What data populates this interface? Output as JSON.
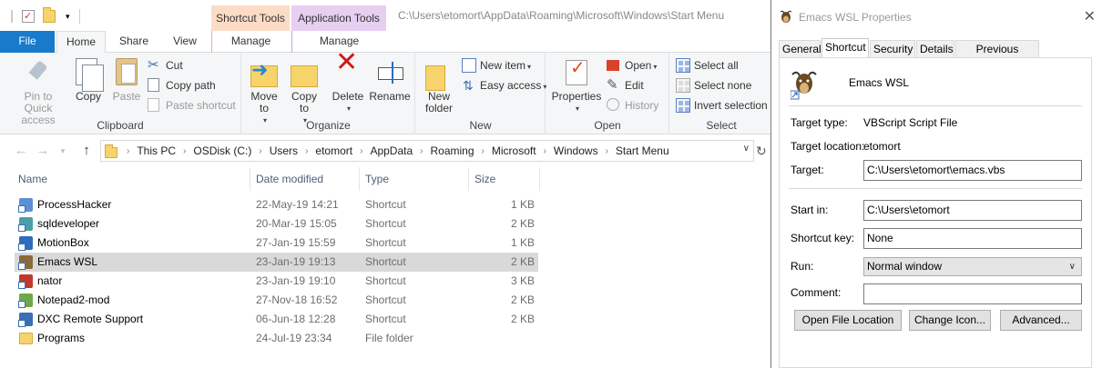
{
  "explorer": {
    "title_path": "C:\\Users\\etomort\\AppData\\Roaming\\Microsoft\\Windows\\Start Menu",
    "context_tabs": {
      "shortcut_tools": "Shortcut Tools",
      "application_tools": "Application Tools"
    },
    "tabs": {
      "file": "File",
      "home": "Home",
      "share": "Share",
      "view": "View",
      "manage1": "Manage",
      "manage2": "Manage"
    },
    "ribbon": {
      "clipboard": {
        "label": "Clipboard",
        "pin": "Pin to Quick access",
        "copy": "Copy",
        "paste": "Paste",
        "cut": "Cut",
        "copy_path": "Copy path",
        "paste_shortcut": "Paste shortcut"
      },
      "organize": {
        "label": "Organize",
        "move_to": "Move to",
        "copy_to": "Copy to",
        "delete": "Delete",
        "rename": "Rename"
      },
      "new": {
        "label": "New",
        "new_folder": "New folder",
        "new_item": "New item",
        "easy_access": "Easy access"
      },
      "open": {
        "label": "Open",
        "properties": "Properties",
        "open": "Open",
        "edit": "Edit",
        "history": "History"
      },
      "select": {
        "label": "Select",
        "select_all": "Select all",
        "select_none": "Select none",
        "invert": "Invert selection"
      }
    },
    "breadcrumbs": [
      "This PC",
      "OSDisk (C:)",
      "Users",
      "etomort",
      "AppData",
      "Roaming",
      "Microsoft",
      "Windows",
      "Start Menu"
    ],
    "columns": {
      "name": "Name",
      "date": "Date modified",
      "type": "Type",
      "size": "Size"
    },
    "files": [
      {
        "name": "ProcessHacker",
        "date": "22-May-19 14:21",
        "type": "Shortcut",
        "size": "1 KB",
        "icon": "process-hacker-icon",
        "color": "#5b8fd6"
      },
      {
        "name": "sqldeveloper",
        "date": "20-Mar-19 15:05",
        "type": "Shortcut",
        "size": "2 KB",
        "icon": "sqldeveloper-icon",
        "color": "#4aa0a8"
      },
      {
        "name": "MotionBox",
        "date": "27-Jan-19 15:59",
        "type": "Shortcut",
        "size": "1 KB",
        "icon": "motionbox-icon",
        "color": "#2f6cc0"
      },
      {
        "name": "Emacs WSL",
        "date": "23-Jan-19 19:13",
        "type": "Shortcut",
        "size": "2 KB",
        "icon": "gnu-icon",
        "color": "#8a6a3a"
      },
      {
        "name": "nator",
        "date": "23-Jan-19 19:10",
        "type": "Shortcut",
        "size": "3 KB",
        "icon": "nator-icon",
        "color": "#c0392b"
      },
      {
        "name": "Notepad2-mod",
        "date": "27-Nov-18 16:52",
        "type": "Shortcut",
        "size": "2 KB",
        "icon": "notepad-icon",
        "color": "#6fa84a"
      },
      {
        "name": "DXC Remote Support",
        "date": "06-Jun-18 12:28",
        "type": "Shortcut",
        "size": "2 KB",
        "icon": "remote-support-icon",
        "color": "#3b6fb5"
      },
      {
        "name": "Programs",
        "date": "24-Jul-19 23:34",
        "type": "File folder",
        "size": "",
        "icon": "folder-icon",
        "color": "#f7d46b"
      }
    ],
    "selected_row": "Emacs WSL"
  },
  "dialog": {
    "title": "Emacs WSL Properties",
    "tabs": [
      "General",
      "Shortcut",
      "Security",
      "Details",
      "Previous Versions"
    ],
    "active_tab": "Shortcut",
    "name": "Emacs WSL",
    "target_type_label": "Target type:",
    "target_type": "VBScript Script File",
    "target_location_label": "Target location:",
    "target_location": "etomort",
    "target_label": "Target:",
    "target": "C:\\Users\\etomort\\emacs.vbs",
    "start_in_label": "Start in:",
    "start_in": "C:\\Users\\etomort",
    "shortcut_key_label": "Shortcut key:",
    "shortcut_key": "None",
    "run_label": "Run:",
    "run": "Normal window",
    "comment_label": "Comment:",
    "comment": "",
    "buttons": {
      "open_location": "Open File Location",
      "change_icon": "Change Icon...",
      "advanced": "Advanced..."
    }
  }
}
